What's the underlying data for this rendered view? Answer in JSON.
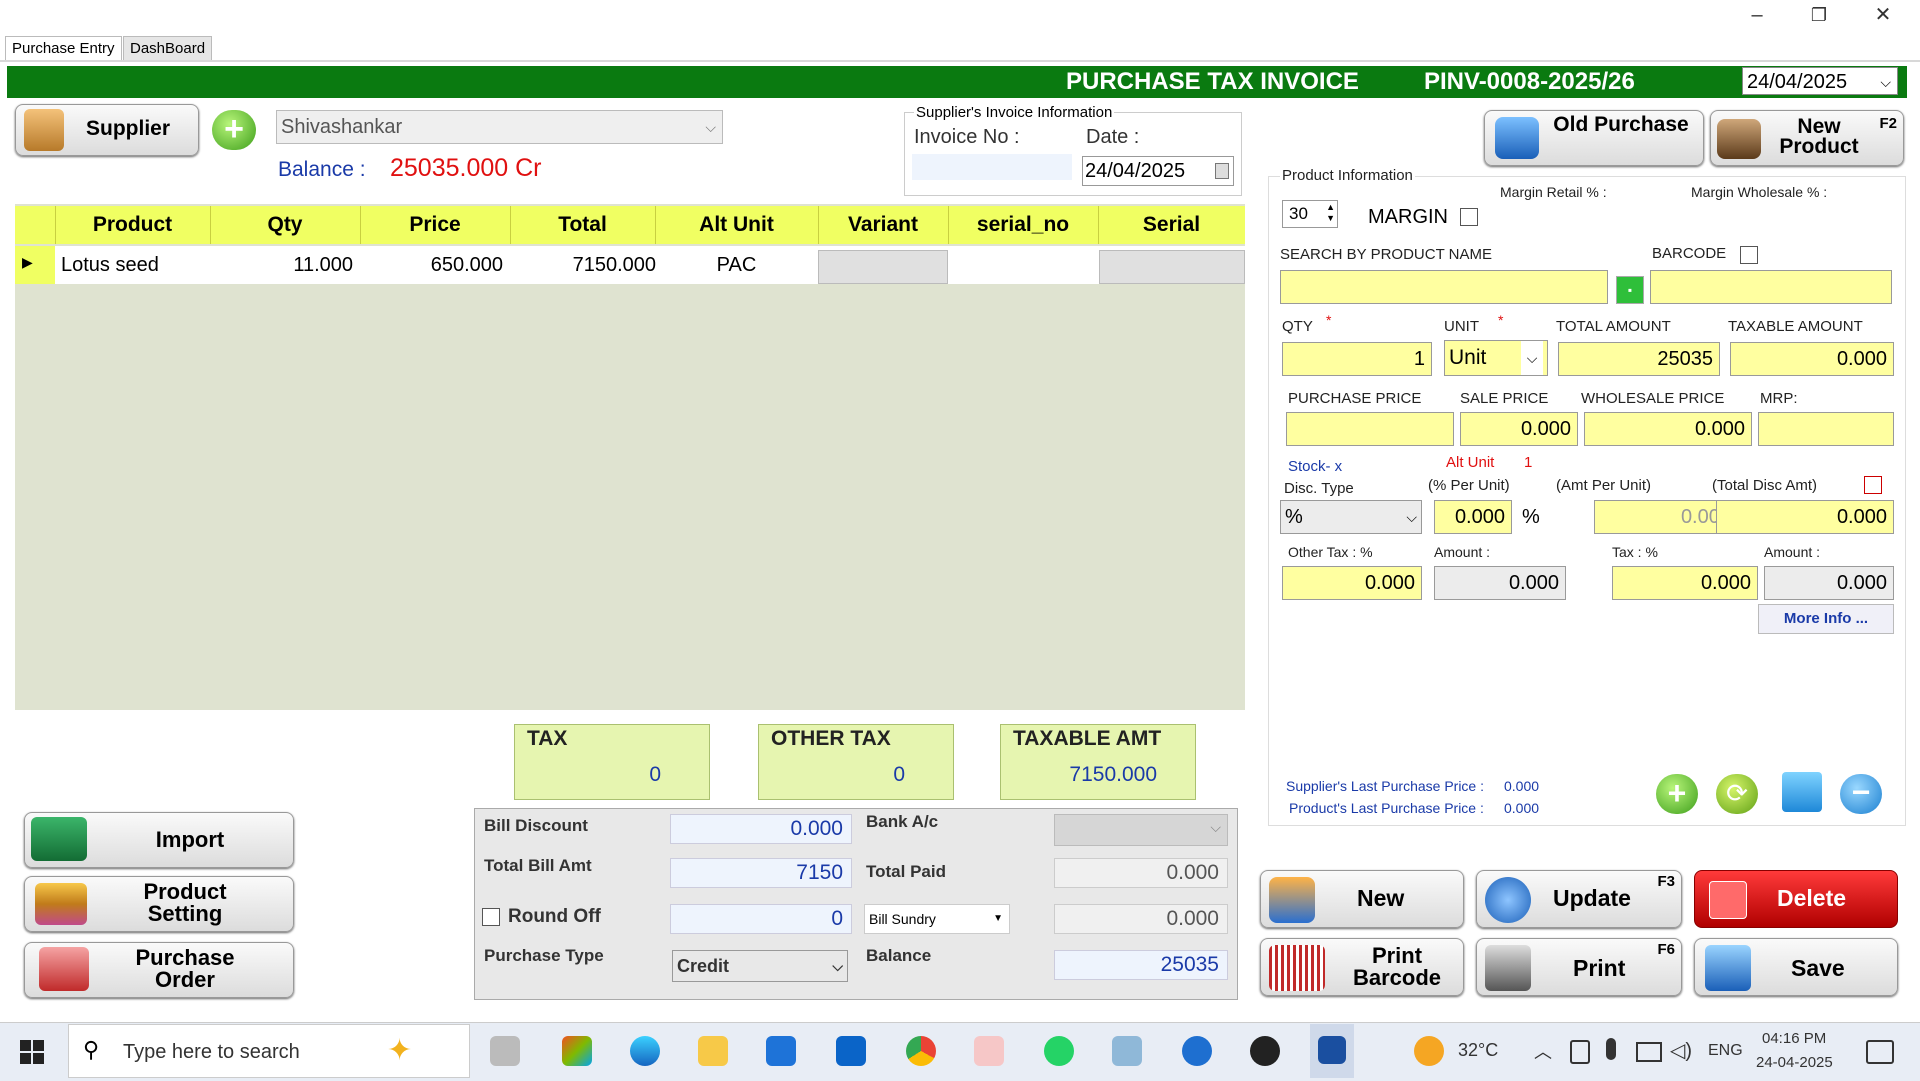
{
  "window": {
    "minimize": "–",
    "restore": "❐",
    "close": "✕"
  },
  "tabs": [
    "Purchase Entry",
    "DashBoard"
  ],
  "header": {
    "title": "PURCHASE TAX INVOICE",
    "invoice_no": "PINV-0008-2025/26",
    "date": "24/04/2025"
  },
  "supplier": {
    "button": "Supplier",
    "name": "Shivashankar",
    "balance_label": "Balance :",
    "balance_value": "25035.000 Cr"
  },
  "supplier_invoice": {
    "group": "Supplier's Invoice Information",
    "invoice_no_label": "Invoice No :",
    "invoice_no": "",
    "date_label": "Date :",
    "date": "24/04/2025"
  },
  "grid": {
    "columns": [
      "Product",
      "Qty",
      "Price",
      "Total",
      "Alt Unit",
      "Variant",
      "serial_no",
      "Serial"
    ],
    "rows": [
      {
        "product": "Lotus seed",
        "qty": "11.000",
        "price": "650.000",
        "total": "7150.000",
        "alt_unit": "PAC",
        "variant": "",
        "serial_no": "",
        "serial": ""
      }
    ]
  },
  "top_buttons": {
    "old_purchase": "Old Purchase",
    "new_product": "New Product",
    "new_product_key": "F2"
  },
  "product_info": {
    "group": "Product Information",
    "margin_retail": "Margin Retail % :",
    "margin_wholesale": "Margin Wholesale % :",
    "spin_value": "30",
    "margin_label": "MARGIN",
    "search_label": "SEARCH BY PRODUCT NAME",
    "barcode_label": "BARCODE",
    "qty_label": "QTY",
    "unit_label": "UNIT",
    "total_amount_label": "TOTAL AMOUNT",
    "taxable_amount_label": "TAXABLE AMOUNT",
    "qty": "1",
    "unit": "Unit",
    "total_amount": "25035",
    "taxable_amount": "0.000",
    "purchase_price_label": "PURCHASE PRICE",
    "sale_price_label": "SALE PRICE",
    "wholesale_price_label": "WHOLESALE PRICE",
    "mrp_label": "MRP:",
    "purchase_price": "",
    "sale_price": "0.000",
    "wholesale_price": "0.000",
    "mrp": "",
    "stock_label": "Stock- x",
    "alt_unit_label": "Alt Unit",
    "alt_unit_value": "1",
    "disc_type_label": "Disc. Type",
    "pct_per_unit_label": "(% Per Unit)",
    "amt_per_unit_label": "(Amt Per Unit)",
    "total_disc_label": "(Total Disc Amt)",
    "disc_type": "%",
    "pct_per_unit": "0.000",
    "pct_sign": "%",
    "amt_per_unit": "0.000",
    "total_disc": "0.000",
    "other_tax_label": "Other Tax : %",
    "amount_label": "Amount :",
    "tax_label": "Tax : %",
    "amount2_label": "Amount :",
    "other_tax": "0.000",
    "other_amount": "0.000",
    "tax": "0.000",
    "tax_amount": "0.000",
    "more_info": "More Info ...",
    "last_supplier_label": "Supplier's Last Purchase Price :",
    "last_supplier_value": "0.000",
    "last_product_label": "Product's Last Purchase Price :",
    "last_product_value": "0.000"
  },
  "totals": {
    "tax_label": "TAX",
    "tax": "0",
    "other_tax_label": "OTHER TAX",
    "other_tax": "0",
    "taxable_label": "TAXABLE AMT",
    "taxable": "7150.000"
  },
  "bill": {
    "bill_discount_label": "Bill Discount",
    "bill_discount": "0.000",
    "bank_label": "Bank A/c",
    "bank": "",
    "total_bill_label": "Total Bill Amt",
    "total_bill": "7150",
    "total_paid_label": "Total Paid",
    "total_paid": "0.000",
    "round_off_label": "Round Off",
    "round_off": "0",
    "bill_sundry_label": "Bill Sundry",
    "bill_sundry": "0.000",
    "purchase_type_label": "Purchase Type",
    "purchase_type": "Credit",
    "balance_label": "Balance",
    "balance": "25035"
  },
  "left_buttons": {
    "import": "Import",
    "product_setting": "Product Setting",
    "purchase_order": "Purchase Order"
  },
  "actions": {
    "new": "New",
    "update": "Update",
    "update_key": "F3",
    "delete": "Delete",
    "print_barcode": "Print Barcode",
    "print": "Print",
    "print_key": "F6",
    "save": "Save"
  },
  "taskbar": {
    "search": "Type here to search",
    "weather": "32°C",
    "lang": "ENG",
    "time": "04:16 PM",
    "date": "24-04-2025"
  }
}
